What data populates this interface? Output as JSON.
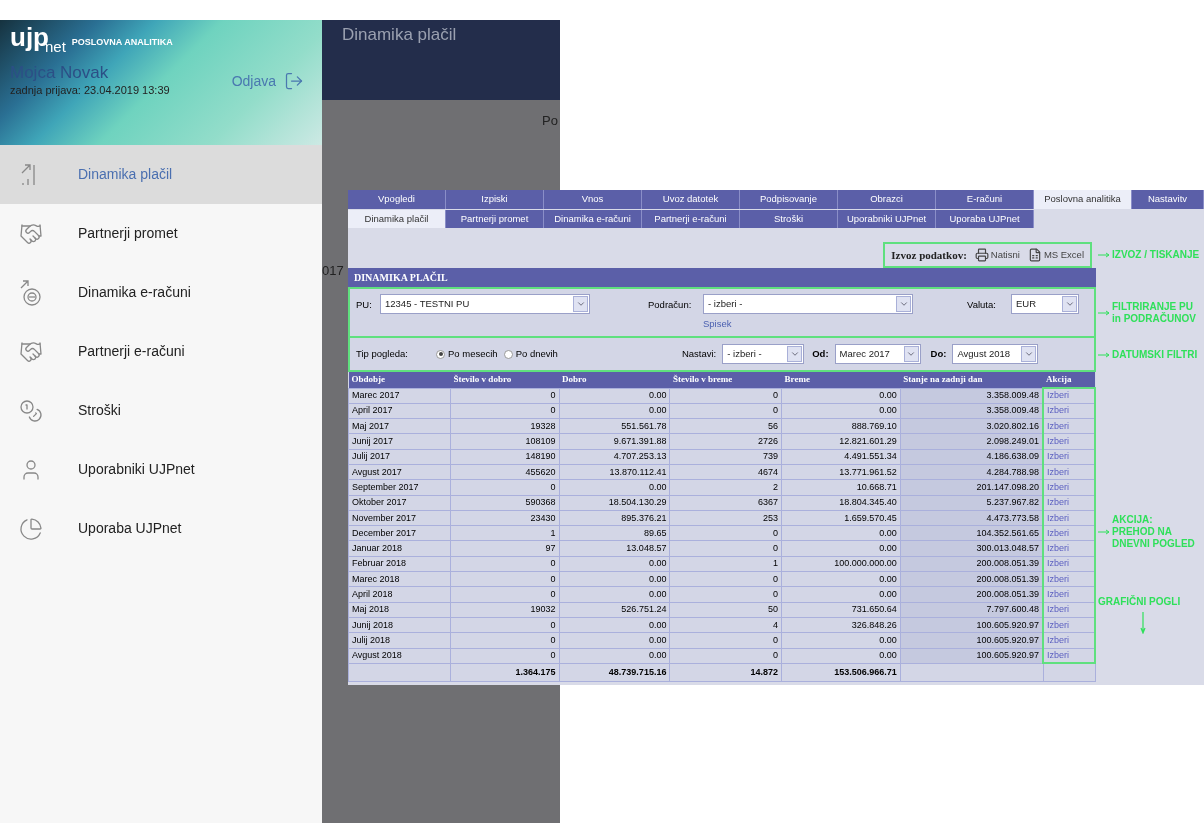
{
  "mobile": {
    "logo": {
      "main": "ujp",
      "sub": "net",
      "tagline": "POSLOVNA ANALITIKA"
    },
    "user": {
      "name": "Mojca Novak",
      "last_login": "zadnja prijava: 23.04.2019 13:39",
      "logout": "Odjava"
    },
    "menu": [
      {
        "label": "Dinamika plačil",
        "selected": true
      },
      {
        "label": "Partnerji promet",
        "selected": false
      },
      {
        "label": "Dinamika e-računi",
        "selected": false
      },
      {
        "label": "Partnerji e-računi",
        "selected": false
      },
      {
        "label": "Stroški",
        "selected": false
      },
      {
        "label": "Uporabniki UJPnet",
        "selected": false
      },
      {
        "label": "Uporaba UJPnet",
        "selected": false
      }
    ],
    "background": {
      "title": "Dinamika plačil",
      "fragment_1": "Po",
      "fragment_2": "017"
    }
  },
  "web": {
    "main_tabs": [
      {
        "label": "Vpogledi",
        "selected": false
      },
      {
        "label": "Izpiski",
        "selected": false
      },
      {
        "label": "Vnos",
        "selected": false
      },
      {
        "label": "Uvoz datotek",
        "selected": false
      },
      {
        "label": "Podpisovanje",
        "selected": false
      },
      {
        "label": "Obrazci",
        "selected": false
      },
      {
        "label": "E-računi",
        "selected": false
      },
      {
        "label": "Poslovna analitika",
        "selected": true
      },
      {
        "label": "Nastavitv",
        "selected": false
      }
    ],
    "sub_tabs": [
      {
        "label": "Dinamika plačil",
        "selected": true
      },
      {
        "label": "Partnerji promet",
        "selected": false
      },
      {
        "label": "Dinamika e-računi",
        "selected": false
      },
      {
        "label": "Partnerji e-računi",
        "selected": false
      },
      {
        "label": "Stroški",
        "selected": false
      },
      {
        "label": "Uporabniki UJPnet",
        "selected": false
      },
      {
        "label": "Uporaba UJPnet",
        "selected": false
      }
    ],
    "export": {
      "label": "Izvoz podatkov:",
      "print": "Natisni",
      "excel": "MS Excel"
    },
    "panel_title": "DINAMIKA PLAČIL",
    "filters": {
      "pu_label": "PU:",
      "pu_value": "12345 - TESTNI PU",
      "account_label": "Podračun:",
      "account_value": "- izberi -",
      "list_link": "Spisek",
      "currency_label": "Valuta:",
      "currency_value": "EUR"
    },
    "view": {
      "label": "Tip pogleda:",
      "options": [
        {
          "label": "Po mesecih",
          "selected": true
        },
        {
          "label": "Po dnevih",
          "selected": false
        }
      ],
      "settings_label": "Nastavi:",
      "settings_value": "- izberi -",
      "from_label": "Od:",
      "from_value": "Marec 2017",
      "to_label": "Do:",
      "to_value": "Avgust 2018"
    },
    "table": {
      "columns": [
        "Obdobje",
        "Število v dobro",
        "Dobro",
        "Število v breme",
        "Breme",
        "Stanje na zadnji dan",
        "Akcija"
      ],
      "rows": [
        {
          "cells": [
            "Marec 2017",
            "0",
            "0.00",
            "0",
            "0.00",
            "3.358.009.48"
          ],
          "action": "Izberi"
        },
        {
          "cells": [
            "April 2017",
            "0",
            "0.00",
            "0",
            "0.00",
            "3.358.009.48"
          ],
          "action": "Izberi"
        },
        {
          "cells": [
            "Maj 2017",
            "19328",
            "551.561.78",
            "56",
            "888.769.10",
            "3.020.802.16"
          ],
          "action": "Izberi"
        },
        {
          "cells": [
            "Junij 2017",
            "108109",
            "9.671.391.88",
            "2726",
            "12.821.601.29",
            "2.098.249.01"
          ],
          "action": "Izberi"
        },
        {
          "cells": [
            "Julij 2017",
            "148190",
            "4.707.253.13",
            "739",
            "4.491.551.34",
            "4.186.638.09"
          ],
          "action": "Izberi"
        },
        {
          "cells": [
            "Avgust 2017",
            "455620",
            "13.870.112.41",
            "4674",
            "13.771.961.52",
            "4.284.788.98"
          ],
          "action": "Izberi"
        },
        {
          "cells": [
            "September 2017",
            "0",
            "0.00",
            "2",
            "10.668.71",
            "201.147.098.20"
          ],
          "action": "Izberi"
        },
        {
          "cells": [
            "Oktober 2017",
            "590368",
            "18.504.130.29",
            "6367",
            "18.804.345.40",
            "5.237.967.82"
          ],
          "action": "Izberi"
        },
        {
          "cells": [
            "November 2017",
            "23430",
            "895.376.21",
            "253",
            "1.659.570.45",
            "4.473.773.58"
          ],
          "action": "Izberi"
        },
        {
          "cells": [
            "December 2017",
            "1",
            "89.65",
            "0",
            "0.00",
            "104.352.561.65"
          ],
          "action": "Izberi"
        },
        {
          "cells": [
            "Januar 2018",
            "97",
            "13.048.57",
            "0",
            "0.00",
            "300.013.048.57"
          ],
          "action": "Izberi"
        },
        {
          "cells": [
            "Februar 2018",
            "0",
            "0.00",
            "1",
            "100.000.000.00",
            "200.008.051.39"
          ],
          "action": "Izberi"
        },
        {
          "cells": [
            "Marec 2018",
            "0",
            "0.00",
            "0",
            "0.00",
            "200.008.051.39"
          ],
          "action": "Izberi"
        },
        {
          "cells": [
            "April 2018",
            "0",
            "0.00",
            "0",
            "0.00",
            "200.008.051.39"
          ],
          "action": "Izberi"
        },
        {
          "cells": [
            "Maj 2018",
            "19032",
            "526.751.24",
            "50",
            "731.650.64",
            "7.797.600.48"
          ],
          "action": "Izberi"
        },
        {
          "cells": [
            "Junij 2018",
            "0",
            "0.00",
            "4",
            "326.848.26",
            "100.605.920.97"
          ],
          "action": "Izberi"
        },
        {
          "cells": [
            "Julij 2018",
            "0",
            "0.00",
            "0",
            "0.00",
            "100.605.920.97"
          ],
          "action": "Izberi"
        },
        {
          "cells": [
            "Avgust 2018",
            "0",
            "0.00",
            "0",
            "0.00",
            "100.605.920.97"
          ],
          "action": "Izberi"
        }
      ],
      "totals": [
        "1.364.175",
        "48.739.715.16",
        "14.872",
        "153.506.966.71"
      ]
    }
  },
  "annotations": {
    "export": "IZVOZ / TISKANJE",
    "filters": [
      "FILTRIRANJE PU",
      "in PODRAČUNOV"
    ],
    "dates": "DATUMSKI FILTRI",
    "action": [
      "AKCIJA:",
      "PREHOD NA",
      "DNEVNI POGLED"
    ],
    "charts": "GRAFIČNI POGLI"
  }
}
